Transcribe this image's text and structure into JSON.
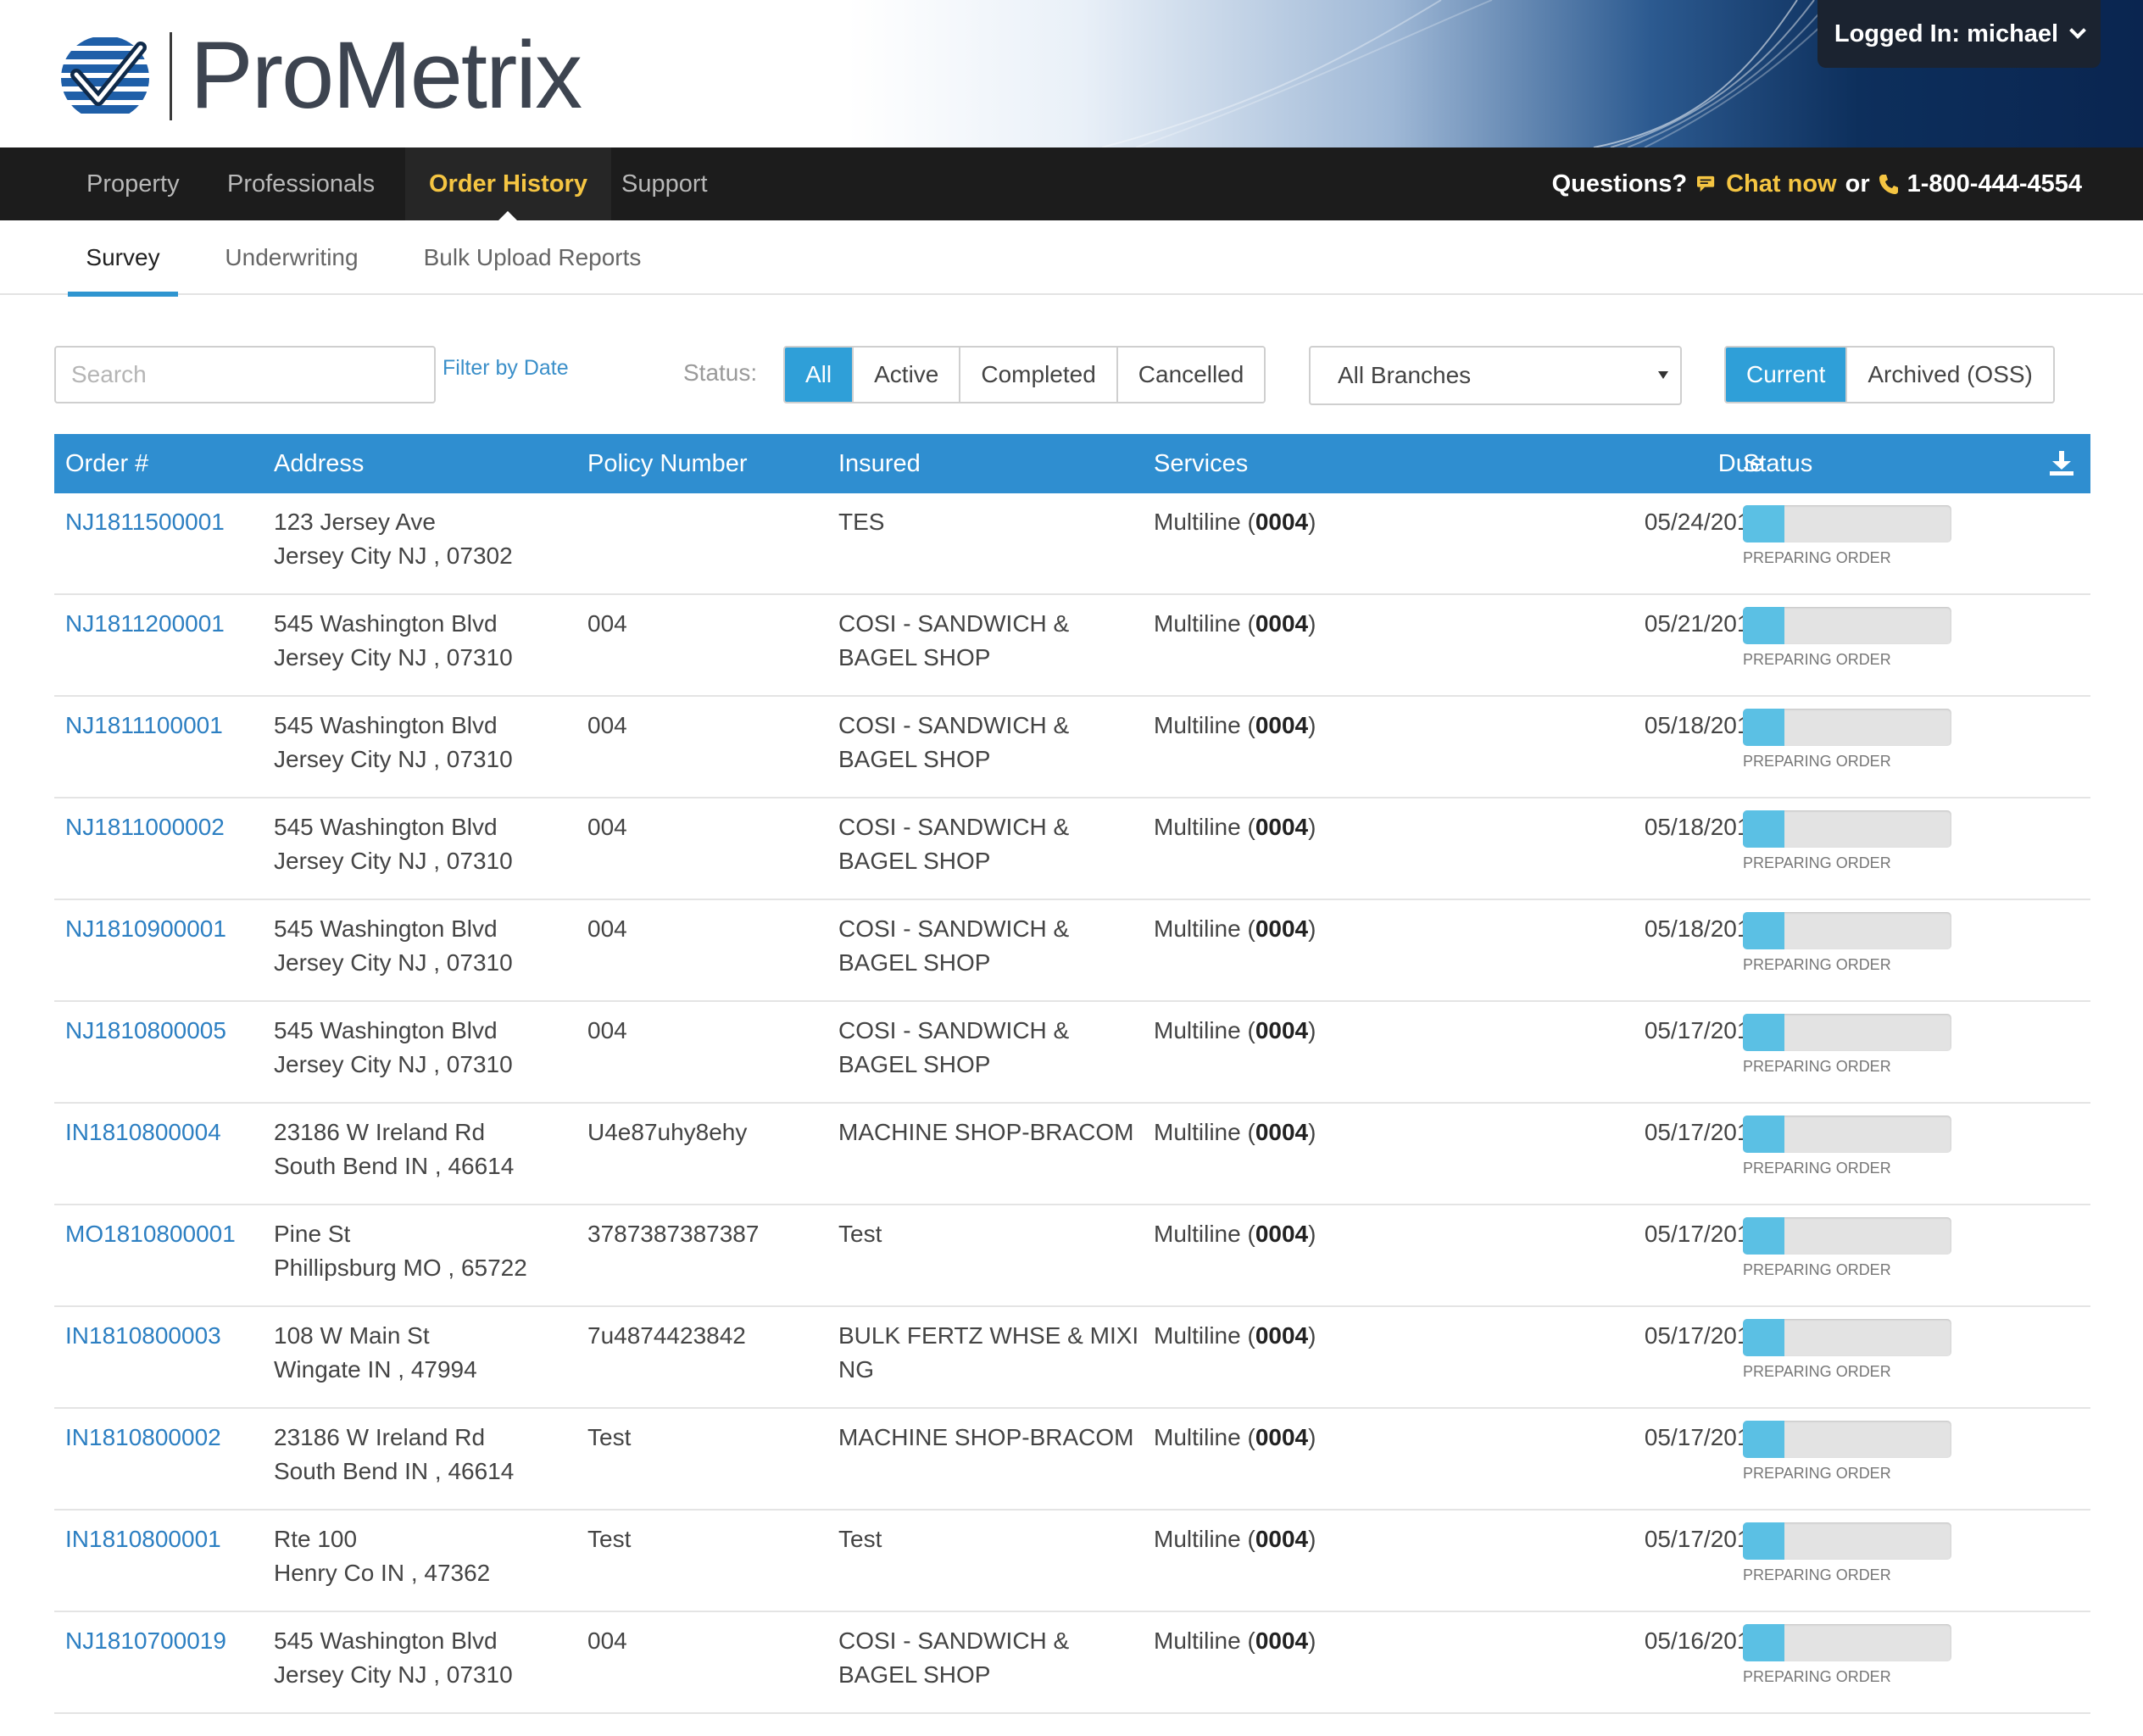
{
  "header": {
    "brand": "ProMetrix",
    "login": "Logged In: michael"
  },
  "nav": {
    "items": [
      "Property",
      "Professionals",
      "Order History",
      "Support"
    ],
    "active": "Order History",
    "questions": "Questions?",
    "chat": "Chat now",
    "or": "or",
    "phone": "1-800-444-4554"
  },
  "subtabs": [
    "Survey",
    "Underwriting",
    "Bulk Upload Reports"
  ],
  "filters": {
    "search_placeholder": "Search",
    "filter_by_date": "Filter by Date",
    "status_label": "Status:",
    "status_options": [
      "All",
      "Active",
      "Completed",
      "Cancelled"
    ],
    "status_selected": "All",
    "branch_select": "All Branches",
    "scope_options": [
      "Current",
      "Archived (OSS)"
    ],
    "scope_selected": "Current"
  },
  "table": {
    "columns": [
      "Order #",
      "Address",
      "Policy Number",
      "Insured",
      "Services",
      "Due",
      "Status"
    ],
    "rows": [
      {
        "order": "NJ1811500001",
        "addr1": "123 Jersey Ave",
        "addr2": "Jersey City NJ ,  07302",
        "policy": "",
        "insured": "TES",
        "svc": "Multiline (",
        "svc_code": "0004",
        "svc_end": ")",
        "due": "05/24/2018",
        "status": "PREPARING ORDER",
        "progress": 0.2
      },
      {
        "order": "NJ1811200001",
        "addr1": "545 Washington Blvd",
        "addr2": "Jersey City NJ ,  07310",
        "policy": "004",
        "insured": "COSI - SANDWICH & BAGEL SHOP",
        "svc": "Multiline (",
        "svc_code": "0004",
        "svc_end": ")",
        "due": "05/21/2018",
        "status": "PREPARING ORDER",
        "progress": 0.2
      },
      {
        "order": "NJ1811100001",
        "addr1": "545 Washington Blvd",
        "addr2": "Jersey City NJ ,  07310",
        "policy": "004",
        "insured": "COSI - SANDWICH & BAGEL SHOP",
        "svc": "Multiline (",
        "svc_code": "0004",
        "svc_end": ")",
        "due": "05/18/2018",
        "status": "PREPARING ORDER",
        "progress": 0.2
      },
      {
        "order": "NJ1811000002",
        "addr1": "545 Washington Blvd",
        "addr2": "Jersey City NJ ,  07310",
        "policy": "004",
        "insured": "COSI - SANDWICH & BAGEL SHOP",
        "svc": "Multiline (",
        "svc_code": "0004",
        "svc_end": ")",
        "due": "05/18/2018",
        "status": "PREPARING ORDER",
        "progress": 0.2
      },
      {
        "order": "NJ1810900001",
        "addr1": "545 Washington Blvd",
        "addr2": "Jersey City NJ ,  07310",
        "policy": "004",
        "insured": "COSI - SANDWICH & BAGEL SHOP",
        "svc": "Multiline (",
        "svc_code": "0004",
        "svc_end": ")",
        "due": "05/18/2018",
        "status": "PREPARING ORDER",
        "progress": 0.2
      },
      {
        "order": "NJ1810800005",
        "addr1": "545 Washington Blvd",
        "addr2": "Jersey City NJ ,  07310",
        "policy": "004",
        "insured": "COSI - SANDWICH & BAGEL SHOP",
        "svc": "Multiline (",
        "svc_code": "0004",
        "svc_end": ")",
        "due": "05/17/2018",
        "status": "PREPARING ORDER",
        "progress": 0.2
      },
      {
        "order": "IN1810800004",
        "addr1": "23186 W Ireland Rd",
        "addr2": "South Bend IN ,  46614",
        "policy": "U4e87uhy8ehy",
        "insured": "MACHINE SHOP-BRACOM",
        "svc": "Multiline (",
        "svc_code": "0004",
        "svc_end": ")",
        "due": "05/17/2018",
        "status": "PREPARING ORDER",
        "progress": 0.2
      },
      {
        "order": "MO1810800001",
        "addr1": "Pine St",
        "addr2": "Phillipsburg MO ,  65722",
        "policy": "3787387387387",
        "insured": "Test",
        "svc": "Multiline (",
        "svc_code": "0004",
        "svc_end": ")",
        "due": "05/17/2018",
        "status": "PREPARING ORDER",
        "progress": 0.2
      },
      {
        "order": "IN1810800003",
        "addr1": "108 W Main St",
        "addr2": "Wingate IN ,  47994",
        "policy": "7u4874423842",
        "insured": "BULK FERTZ WHSE & MIXI NG",
        "svc": "Multiline (",
        "svc_code": "0004",
        "svc_end": ")",
        "due": "05/17/2018",
        "status": "PREPARING ORDER",
        "progress": 0.2
      },
      {
        "order": "IN1810800002",
        "addr1": "23186 W Ireland Rd",
        "addr2": "South Bend IN ,  46614",
        "policy": "Test",
        "insured": "MACHINE SHOP-BRACOM",
        "svc": "Multiline (",
        "svc_code": "0004",
        "svc_end": ")",
        "due": "05/17/2018",
        "status": "PREPARING ORDER",
        "progress": 0.2
      },
      {
        "order": "IN1810800001",
        "addr1": "Rte 100",
        "addr2": "Henry Co IN ,  47362",
        "policy": "Test",
        "insured": "Test",
        "svc": "Multiline (",
        "svc_code": "0004",
        "svc_end": ")",
        "due": "05/17/2018",
        "status": "PREPARING ORDER",
        "progress": 0.2
      },
      {
        "order": "NJ1810700019",
        "addr1": "545 Washington Blvd",
        "addr2": "Jersey City NJ ,  07310",
        "policy": "004",
        "insured": "COSI - SANDWICH & BAGEL SHOP",
        "svc": "Multiline (",
        "svc_code": "0004",
        "svc_end": ")",
        "due": "05/16/2018",
        "status": "PREPARING ORDER",
        "progress": 0.2
      }
    ]
  },
  "colors": {
    "accent": "#2f8ed0",
    "nav_bg": "#1c1c1c",
    "active_nav": "#f5c542",
    "progress_fill": "#5bc0e4",
    "link": "#2c7fc2"
  },
  "icons": [
    "logo-check-icon",
    "chevron-down-icon",
    "chat-icon",
    "phone-icon",
    "download-icon",
    "select-arrow-icon"
  ]
}
